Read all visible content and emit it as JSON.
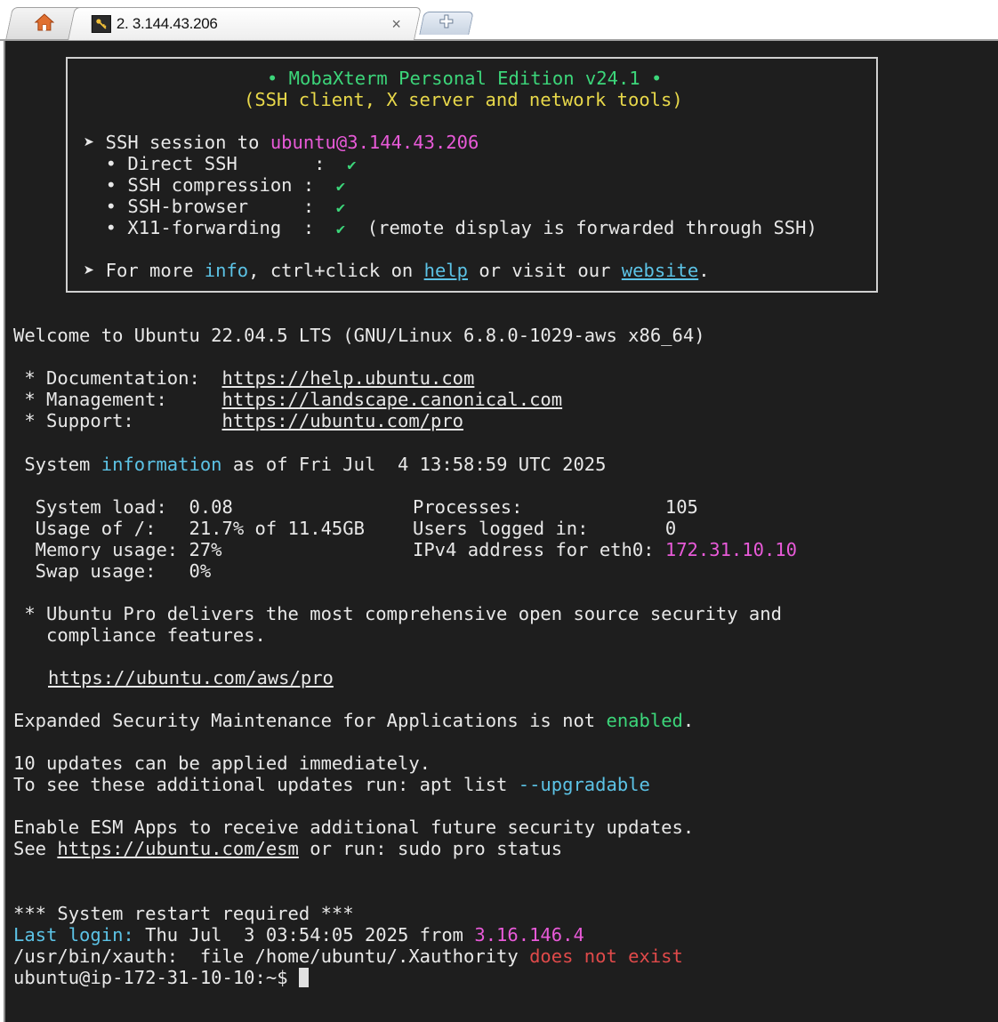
{
  "tabs": {
    "session_title": "2. 3.144.43.206",
    "close_glyph": "×",
    "icons": [
      "home-icon",
      "key-icon",
      "close-icon",
      "new-tab-icon"
    ]
  },
  "banner": {
    "title": "• MobaXterm Personal Edition v24.1 •",
    "subtitle": "(SSH client, X server and network tools)",
    "session_prefix": "➤ SSH session to ",
    "session_target": "ubuntu@3.144.43.206",
    "features": [
      {
        "label": "  • Direct SSH       :  ",
        "check": "✔",
        "note": ""
      },
      {
        "label": "  • SSH compression :  ",
        "check": "✔",
        "note": ""
      },
      {
        "label": "  • SSH-browser     :  ",
        "check": "✔",
        "note": ""
      },
      {
        "label": "  • X11-forwarding  :  ",
        "check": "✔",
        "note": "  (remote display is forwarded through SSH)"
      }
    ],
    "more_prefix": "➤ For more ",
    "more_info": "info",
    "more_mid": ", ctrl+click on ",
    "more_help": "help",
    "more_or": " or visit our ",
    "more_website": "website",
    "more_end": "."
  },
  "terminal": {
    "welcome": "Welcome to Ubuntu 22.04.5 LTS (GNU/Linux 6.8.0-1029-aws x86_64)",
    "doc_label": " * Documentation:  ",
    "doc_url": "https://help.ubuntu.com",
    "mgmt_label": " * Management:     ",
    "mgmt_url": "https://landscape.canonical.com",
    "support_label": " * Support:        ",
    "support_url": "https://ubuntu.com/pro",
    "sysinfo_prefix": " System ",
    "sysinfo_word": "information",
    "sysinfo_suffix": " as of Fri Jul  4 13:58:59 UTC 2025",
    "stats_left": [
      "  System load:  0.08",
      "  Usage of /:   21.7% of 11.45GB",
      "  Memory usage: 27%",
      "  Swap usage:   0%"
    ],
    "stats_right": [
      "Processes:             105",
      "Users logged in:       0",
      "IPv4 address for eth0: "
    ],
    "ipv4": "172.31.10.10",
    "pro_line1": " * Ubuntu Pro delivers the most comprehensive open source security and",
    "pro_line2": "   compliance features.",
    "pro_url": "https://ubuntu.com/aws/pro",
    "esm_prefix": "Expanded Security Maintenance for Applications is not ",
    "esm_word": "enabled",
    "esm_end": ".",
    "updates_line1": "10 updates can be applied immediately.",
    "updates_line2_prefix": "To see these additional updates run: apt list ",
    "updates_line2_flag": "--upgradable",
    "enable_line1": "Enable ESM Apps to receive additional future security updates.",
    "enable_see": "See ",
    "enable_url": "https://ubuntu.com/esm",
    "enable_rest": " or run: sudo pro status",
    "restart": "*** System restart required ***",
    "last_login_label": "Last login:",
    "last_login_text": " Thu Jul  3 03:54:05 2025 from ",
    "last_login_ip": "3.16.146.4",
    "xauth_text": "/usr/bin/xauth:  file /home/ubuntu/.Xauthority ",
    "xauth_error": "does not exist",
    "prompt": "ubuntu@ip-172-31-10-10:~$ "
  },
  "colors": {
    "background": "#1e1e1e",
    "text": "#e8e8e8",
    "green": "#3cd67a",
    "yellow": "#e8d84a",
    "magenta": "#e85ad8",
    "cyan": "#5cc3e6",
    "red": "#e04a4a"
  }
}
